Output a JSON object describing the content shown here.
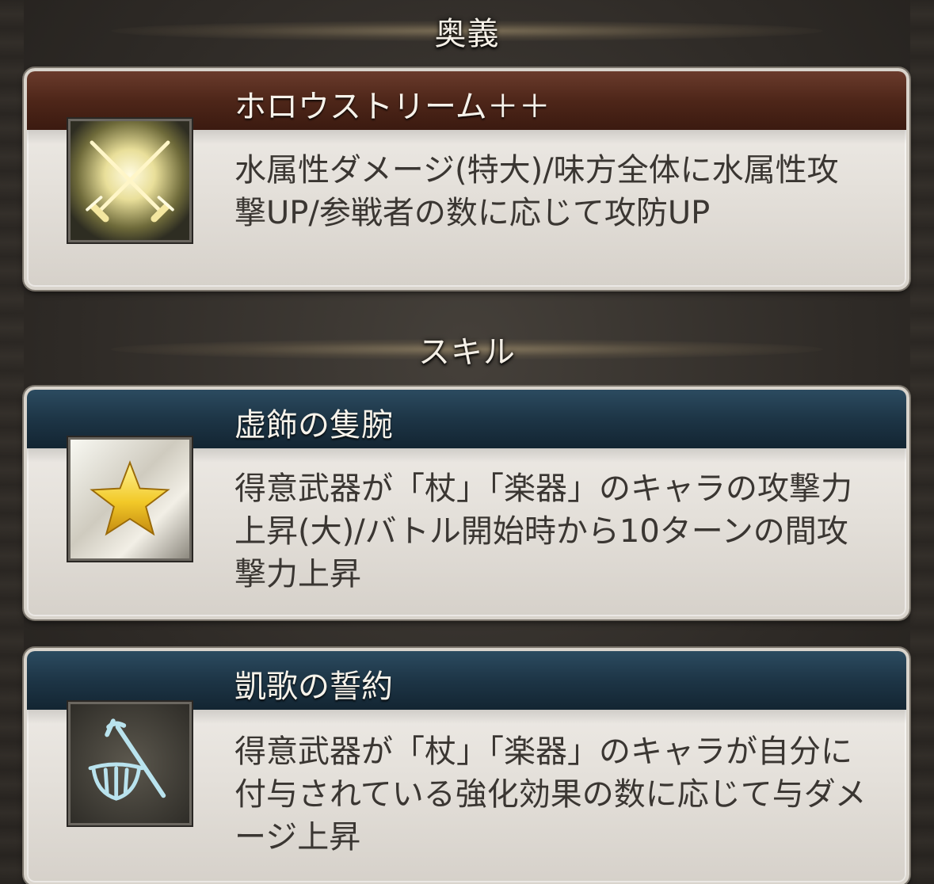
{
  "sections": {
    "ougi": {
      "title": "奥義",
      "card": {
        "name": "ホロウストリーム＋＋",
        "description": "水属性ダメージ(特大)/味方全体に水属性攻撃UP/参戦者の数に応じて攻防UP",
        "icon": "crossed-swords-icon",
        "band_color": "#4e2619"
      }
    },
    "skill": {
      "title": "スキル",
      "cards": [
        {
          "name": "虚飾の隻腕",
          "description": "得意武器が「杖」「楽器」のキャラの攻撃力上昇(大)/バトル開始時から10ターンの間攻撃力上昇",
          "icon": "gold-star-icon",
          "band_color": "#1d3546"
        },
        {
          "name": "凱歌の誓約",
          "description": "得意武器が「杖」「楽器」のキャラが自分に付与されている強化効果の数に応じて与ダメージ上昇",
          "icon": "staff-and-harp-icon",
          "band_color": "#1d3546"
        }
      ]
    }
  }
}
